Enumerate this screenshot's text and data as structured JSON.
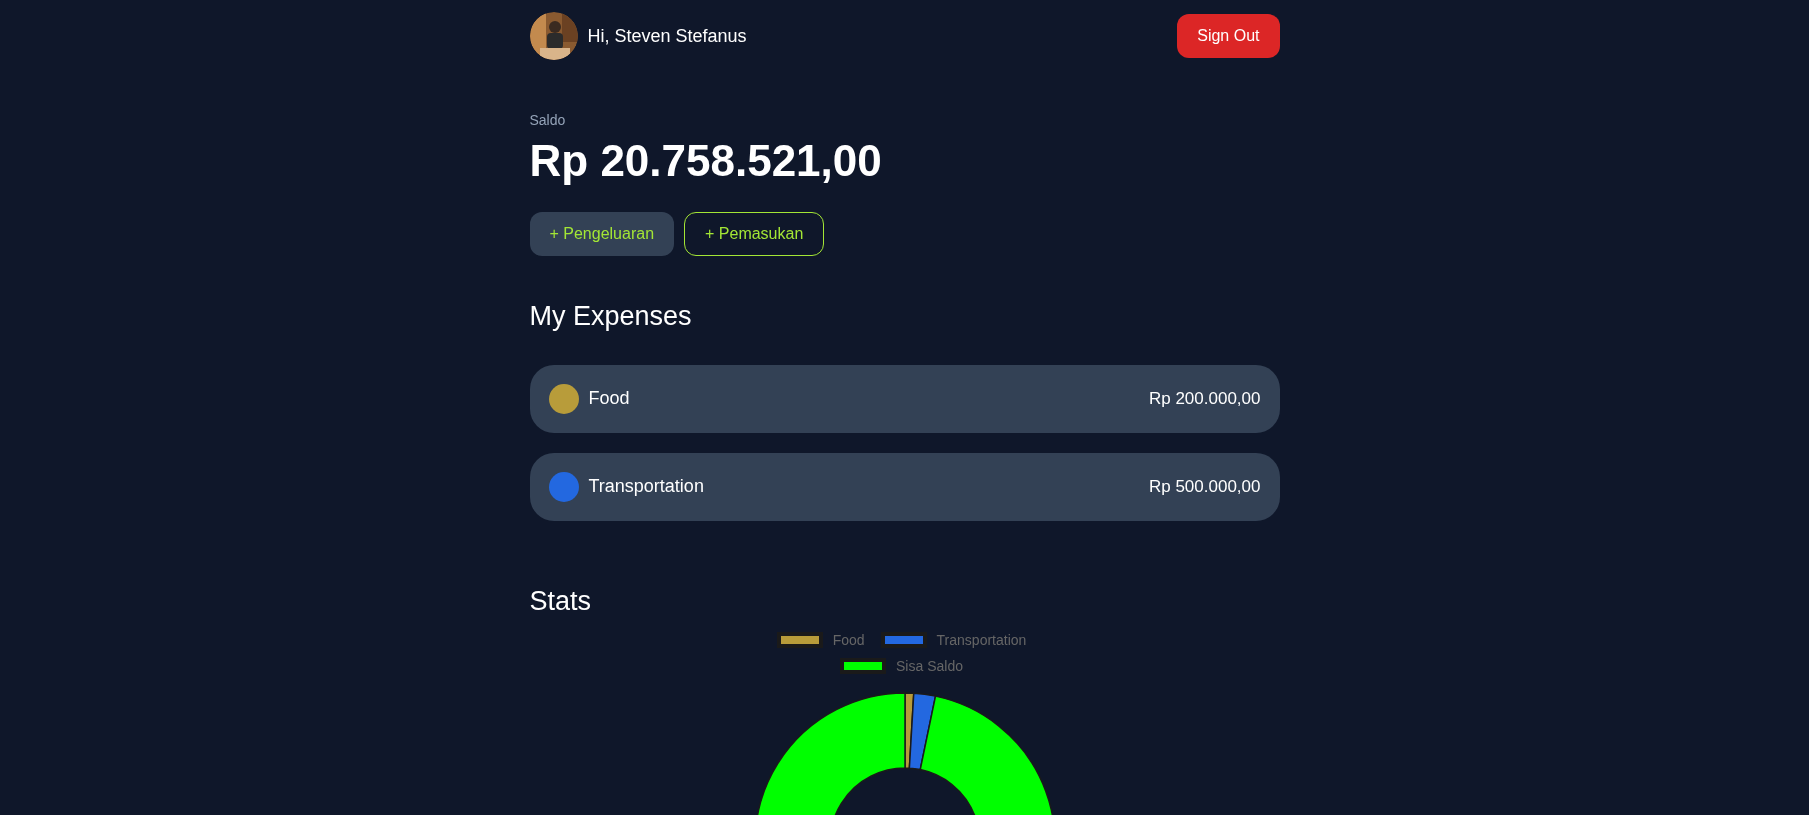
{
  "header": {
    "greeting": "Hi, Steven Stefanus",
    "sign_out": "Sign Out"
  },
  "balance": {
    "label": "Saldo",
    "amount": "Rp 20.758.521,00"
  },
  "actions": [
    {
      "label": "+ Pengeluaran",
      "kind": "filled"
    },
    {
      "label": "+ Pemasukan",
      "kind": "outline"
    }
  ],
  "expenses": {
    "title": "My Expenses",
    "items": [
      {
        "name": "Food",
        "amount": "Rp 200.000,00",
        "color": "#b89c3a"
      },
      {
        "name": "Transportation",
        "amount": "Rp 500.000,00",
        "color": "#2368e0"
      }
    ]
  },
  "stats": {
    "title": "Stats",
    "chart_data": {
      "type": "donut",
      "categories": [
        "Food",
        "Transportation",
        "Sisa Saldo"
      ],
      "values": [
        0.93,
        2.33,
        96.74
      ],
      "legend": "top",
      "colors": [
        "#b89c3a",
        "#2368e0",
        "#00ff00"
      ]
    }
  }
}
